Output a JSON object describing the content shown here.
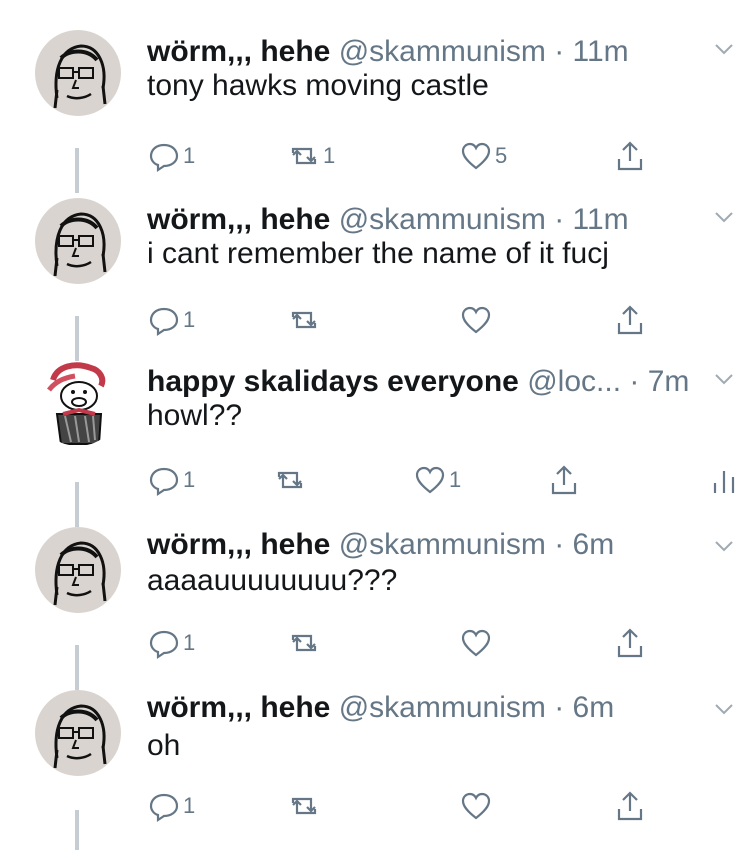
{
  "tweets": [
    {
      "name": "wörm,,, hehe",
      "handle": "@skammunism",
      "time": "· 11m",
      "text": "tony hawks moving castle",
      "replies": "1",
      "retweets": "1",
      "likes": "5",
      "avatar": "worm-avatar"
    },
    {
      "name": "wörm,,, hehe",
      "handle": "@skammunism",
      "time": "· 11m",
      "text": "i cant remember the name of it fucj",
      "replies": "1",
      "retweets": "",
      "likes": "",
      "avatar": "worm-avatar"
    },
    {
      "name": "happy skalidays everyone",
      "handle": "@loc...",
      "time": "· 7m",
      "text": "howl??",
      "replies": "1",
      "retweets": "",
      "likes": "1",
      "avatar": "skalidays-avatar",
      "has_analytics": true
    },
    {
      "name": "wörm,,, hehe",
      "handle": "@skammunism",
      "time": "· 6m",
      "text": "aaaauuuuuuuu???",
      "replies": "1",
      "retweets": "",
      "likes": "",
      "avatar": "worm-avatar"
    },
    {
      "name": "wörm,,, hehe",
      "handle": "@skammunism",
      "time": "· 6m",
      "text": "oh",
      "replies": "1",
      "retweets": "",
      "likes": "",
      "avatar": "worm-avatar"
    }
  ],
  "colors": {
    "text": "#14171a",
    "secondary": "#657786",
    "thread_line": "#c5cdd3",
    "avatar_bg": "#d9d4cf"
  }
}
